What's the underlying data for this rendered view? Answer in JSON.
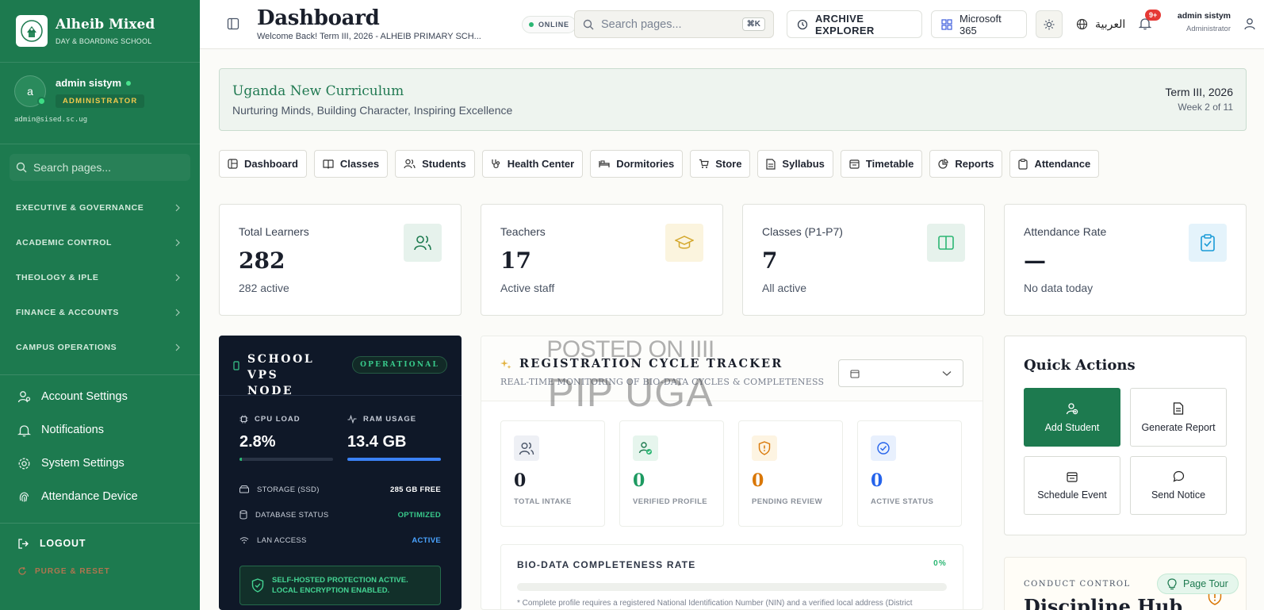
{
  "sidebar": {
    "school_name": "Alheib Mixed",
    "school_sub": "DAY & BOARDING SCHOOL",
    "user": {
      "initial": "a",
      "name": "admin sistym",
      "role": "ADMINISTRATOR",
      "email": "admin@sised.sc.ug"
    },
    "search_placeholder": "Search pages...",
    "groups": [
      "EXECUTIVE & GOVERNANCE",
      "ACADEMIC CONTROL",
      "THEOLOGY & IPLE",
      "FINANCE & ACCOUNTS",
      "CAMPUS OPERATIONS"
    ],
    "links": [
      "Account Settings",
      "Notifications",
      "System Settings",
      "Attendance Device"
    ],
    "logout": "LOGOUT",
    "purge": "PURGE & RESET"
  },
  "header": {
    "title": "Dashboard",
    "subtitle": "Welcome Back! Term III, 2026 - ALHEIB PRIMARY SCH...",
    "status": "ONLINE",
    "search_placeholder": "Search pages...",
    "shortcut": "⌘K",
    "archive": "ARCHIVE EXPLORER",
    "microsoft": "Microsoft 365",
    "language": "العربية",
    "notif_count": "9+",
    "user_name": "admin sistym",
    "user_role": "Administrator"
  },
  "banner": {
    "title": "Uganda New Curriculum",
    "tagline": "Nurturing Minds, Building Character, Inspiring Excellence",
    "term": "Term III, 2026",
    "week": "Week 2 of 11"
  },
  "tabs": [
    "Dashboard",
    "Classes",
    "Students",
    "Health Center",
    "Dormitories",
    "Store",
    "Syllabus",
    "Timetable",
    "Reports",
    "Attendance"
  ],
  "stats": [
    {
      "label": "Total Learners",
      "value": "282",
      "sub": "282 active"
    },
    {
      "label": "Teachers",
      "value": "17",
      "sub": "Active staff"
    },
    {
      "label": "Classes (P1-P7)",
      "value": "7",
      "sub": "All active"
    },
    {
      "label": "Attendance Rate",
      "value": "—",
      "sub": "No data today"
    }
  ],
  "vps": {
    "title_line1": "SCHOOL VPS",
    "title_line2": "NODE",
    "status": "OPERATIONAL",
    "cpu_label": "CPU LOAD",
    "cpu_value": "2.8%",
    "cpu_fraction": 0.028,
    "ram_label": "RAM USAGE",
    "ram_value": "13.4 GB",
    "ram_fraction": 1.0,
    "rows": [
      {
        "key": "STORAGE (SSD)",
        "value": "285 GB FREE"
      },
      {
        "key": "DATABASE STATUS",
        "value": "OPTIMIZED"
      },
      {
        "key": "LAN ACCESS",
        "value": "ACTIVE"
      }
    ],
    "secure_line1": "SELF-HOSTED PROTECTION ACTIVE.",
    "secure_line2": "LOCAL ENCRYPTION ENABLED."
  },
  "registration": {
    "title": "REGISTRATION CYCLE TRACKER",
    "subtitle": "REAL-TIME MONITORING OF BIO-DATA CYCLES & COMPLETENESS",
    "cards": [
      {
        "value": "0",
        "label": "TOTAL INTAKE"
      },
      {
        "value": "0",
        "label": "VERIFIED PROFILE"
      },
      {
        "value": "0",
        "label": "PENDING REVIEW"
      },
      {
        "value": "0",
        "label": "ACTIVE STATUS"
      }
    ],
    "completeness_label": "BIO-DATA COMPLETENESS RATE",
    "completeness_value": "0%",
    "completeness_fraction": 0,
    "note": "* Complete profile requires a registered National Identification Number (NIN) and a verified local address (District"
  },
  "watermark": {
    "line1": "POSTED ON IIII",
    "line2": "PIP UGA"
  },
  "quick_actions": {
    "title": "Quick Actions",
    "buttons": [
      "Add Student",
      "Generate Report",
      "Schedule Event",
      "Send Notice"
    ]
  },
  "discipline": {
    "kicker": "CONDUCT CONTROL",
    "title": "Discipline Hub"
  },
  "page_tour": "Page Tour",
  "colors": {
    "brand": "#1d7a4f",
    "accent_gold": "#f2c94c",
    "dark_panel": "#0f1828",
    "green": "#2bb673",
    "blue": "#3b82f6",
    "orange": "#d97706"
  }
}
